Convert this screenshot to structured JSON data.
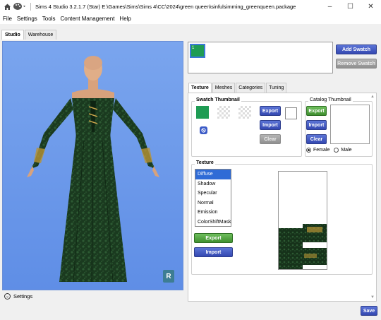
{
  "titlebar": {
    "title": "Sims 4 Studio 3.2.1.7 (Star)  E:\\Games\\Sims\\Sims 4\\CC\\2024\\green queen\\sinfulsimming_greenqueen.package",
    "icons": [
      "home-icon",
      "palette-icon"
    ],
    "minimize": "–",
    "maximize": "☐",
    "close": "✕"
  },
  "menu": {
    "file": "File",
    "settings": "Settings",
    "tools": "Tools",
    "content": "Content Management",
    "help": "Help"
  },
  "top_tabs": {
    "studio": "Studio",
    "warehouse": "Warehouse",
    "active": "Studio"
  },
  "viewport": {
    "logo_letter": "R",
    "settings_label": "Settings"
  },
  "swatch": {
    "item_number": "1",
    "item_color": "#1f9c54",
    "add_label": "Add Swatch",
    "remove_label": "Remove Swatch"
  },
  "subtabs": {
    "texture": "Texture",
    "meshes": "Meshes",
    "categories": "Categories",
    "tuning": "Tuning",
    "active": "Texture"
  },
  "swatch_thumbnail": {
    "title": "Swatch Thumbnail",
    "color": "#1f9c54",
    "export_label": "Export",
    "import_label": "Import",
    "clear_label": "Clear"
  },
  "catalog_thumbnail": {
    "title": "Catalog Thumbnail",
    "export_label": "Export",
    "import_label": "Import",
    "clear_label": "Clear",
    "female_label": "Female",
    "male_label": "Male",
    "selected_gender": "Female"
  },
  "texture": {
    "title": "Texture",
    "items": [
      "Diffuse",
      "Shadow",
      "Specular",
      "Normal",
      "Emission",
      "ColorShiftMask"
    ],
    "selected": "Diffuse",
    "export_label": "Export",
    "import_label": "Import"
  },
  "footer": {
    "save_label": "Save"
  },
  "colors": {
    "accent_blue": "#3448b1",
    "accent_green": "#3f8f2f",
    "viewport_bg": "#6a96ea",
    "dress": "#1d3b20",
    "gold_trim": "#c7a34a"
  }
}
